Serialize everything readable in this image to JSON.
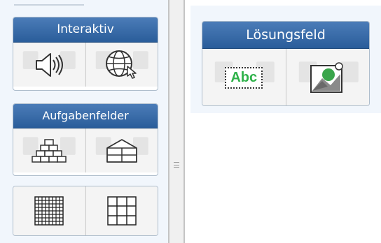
{
  "interaktiv": {
    "title": "Interaktiv",
    "tiles": [
      {
        "icon": "speaker-icon",
        "label": ""
      },
      {
        "icon": "globe-cursor-icon",
        "label": ""
      }
    ]
  },
  "aufgabenfelder": {
    "title": "Aufgabenfelder",
    "tiles": [
      {
        "icon": "brick-pyramid-icon"
      },
      {
        "icon": "house-grid-icon"
      },
      {
        "icon": "fine-grid-icon"
      },
      {
        "icon": "coarse-grid-icon"
      }
    ]
  },
  "loesungsfeld": {
    "title": "Lösungsfeld",
    "text_tile_label": "Abc",
    "tiles": [
      {
        "icon": "text-field-icon"
      },
      {
        "icon": "image-field-icon"
      }
    ]
  },
  "colors": {
    "header_blue": "#2f63a3",
    "abc_green": "#2fb24a",
    "panel_bg": "#f1f6fc"
  }
}
